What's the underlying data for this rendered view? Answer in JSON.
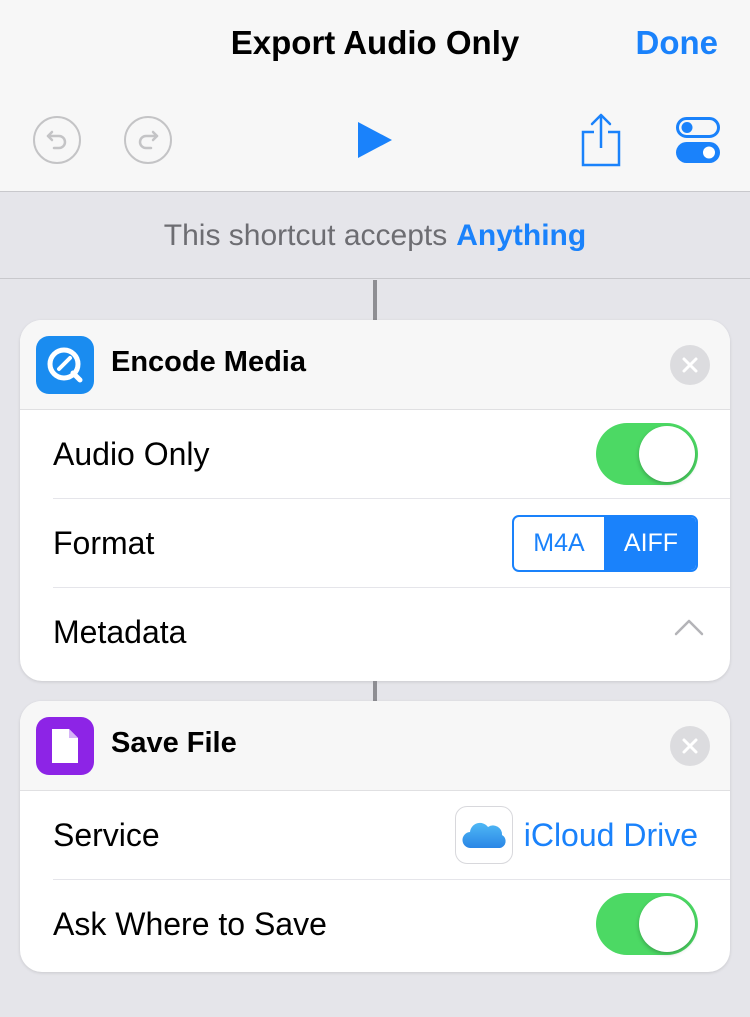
{
  "header": {
    "title": "Export Audio Only",
    "done_label": "Done"
  },
  "toolbar": {
    "undo_icon": "undo-icon",
    "redo_icon": "redo-icon",
    "play_icon": "play-icon",
    "share_icon": "share-icon",
    "settings_icon": "settings-toggles-icon"
  },
  "accepts": {
    "prefix": "This shortcut accepts",
    "value": "Anything"
  },
  "actions": [
    {
      "title": "Encode Media",
      "icon": "quicktime-icon",
      "icon_color": "#1a8cf0",
      "rows": {
        "audio_only": {
          "label": "Audio Only",
          "on": true
        },
        "format": {
          "label": "Format",
          "options": [
            "M4A",
            "AIFF"
          ],
          "selected": "AIFF"
        },
        "metadata": {
          "label": "Metadata",
          "expanded": true
        }
      }
    },
    {
      "title": "Save File",
      "icon": "document-icon",
      "icon_color": "#8d24e6",
      "rows": {
        "service": {
          "label": "Service",
          "value": "iCloud Drive",
          "icon": "icloud-icon"
        },
        "ask_where": {
          "label": "Ask Where to Save",
          "on": true
        }
      }
    }
  ],
  "colors": {
    "accent": "#1a82fb",
    "toggle_on": "#4cd964"
  }
}
